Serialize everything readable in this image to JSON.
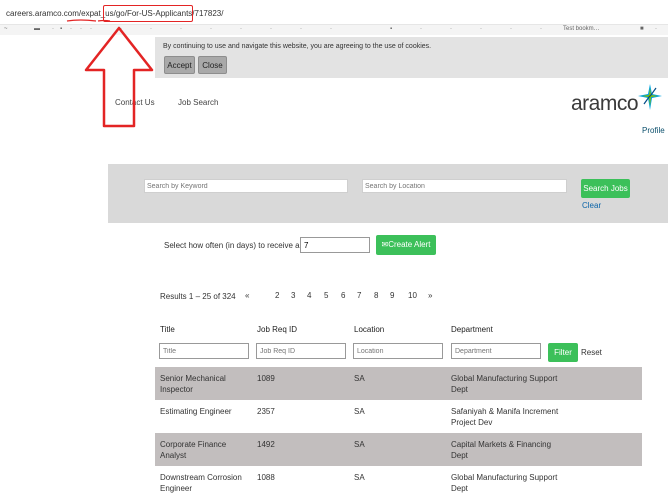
{
  "browser": {
    "url": "careers.aramco.com/expat_us/go/For-US-Applicants/717823/",
    "toolbar_glyphs": [
      "~",
      "▬",
      "·",
      "▪",
      "·",
      "·",
      "·",
      "·",
      "·",
      "·",
      "·",
      "·",
      "·",
      "·",
      "·",
      "▪",
      "·",
      "·",
      "·",
      "·",
      "·",
      "■",
      "·"
    ],
    "toolbar_text": "Test bookm…"
  },
  "cookie_banner": {
    "message": "By continuing to use and navigate this website, you are agreeing to the use of cookies.",
    "accept_label": "Accept",
    "close_label": "Close"
  },
  "header": {
    "nav": [
      "Contact Us",
      "Job Search"
    ],
    "logo_text": "aramco",
    "profile_label": "Profile"
  },
  "search": {
    "keyword_placeholder": "Search by Keyword",
    "location_placeholder": "Search by Location",
    "search_label": "Search Jobs",
    "clear_label": "Clear"
  },
  "alert": {
    "label": "Select how often (in days) to receive an alert:",
    "value": "7",
    "button_label": "Create Alert"
  },
  "results": {
    "label": "Results 1 – 25 of 324",
    "pages": [
      "«",
      "2",
      "3",
      "4",
      "5",
      "6",
      "7",
      "8",
      "9",
      "10",
      "»"
    ]
  },
  "table": {
    "headers": [
      "Title",
      "Job Req ID",
      "Location",
      "Department"
    ],
    "filter_placeholders": [
      "Title",
      "Job Req ID",
      "Location",
      "Department"
    ],
    "filter_label": "Filter",
    "reset_label": "Reset",
    "rows": [
      {
        "title": "Senior Mechanical Inspector",
        "req_id": "1089",
        "location": "SA",
        "department": "Global Manufacturing Support Dept"
      },
      {
        "title": "Estimating Engineer",
        "req_id": "2357",
        "location": "SA",
        "department": "Safaniyah & Manifa Increment Project Dev"
      },
      {
        "title": "Corporate Finance Analyst",
        "req_id": "1492",
        "location": "SA",
        "department": "Capital Markets & Financing Dept"
      },
      {
        "title": "Downstream Corrosion Engineer",
        "req_id": "1088",
        "location": "SA",
        "department": "Global Manufacturing Support Dept"
      }
    ]
  },
  "colors": {
    "green": "#3cc05a",
    "annotation_red": "#e32424",
    "row_grey": "#c2bebe"
  }
}
